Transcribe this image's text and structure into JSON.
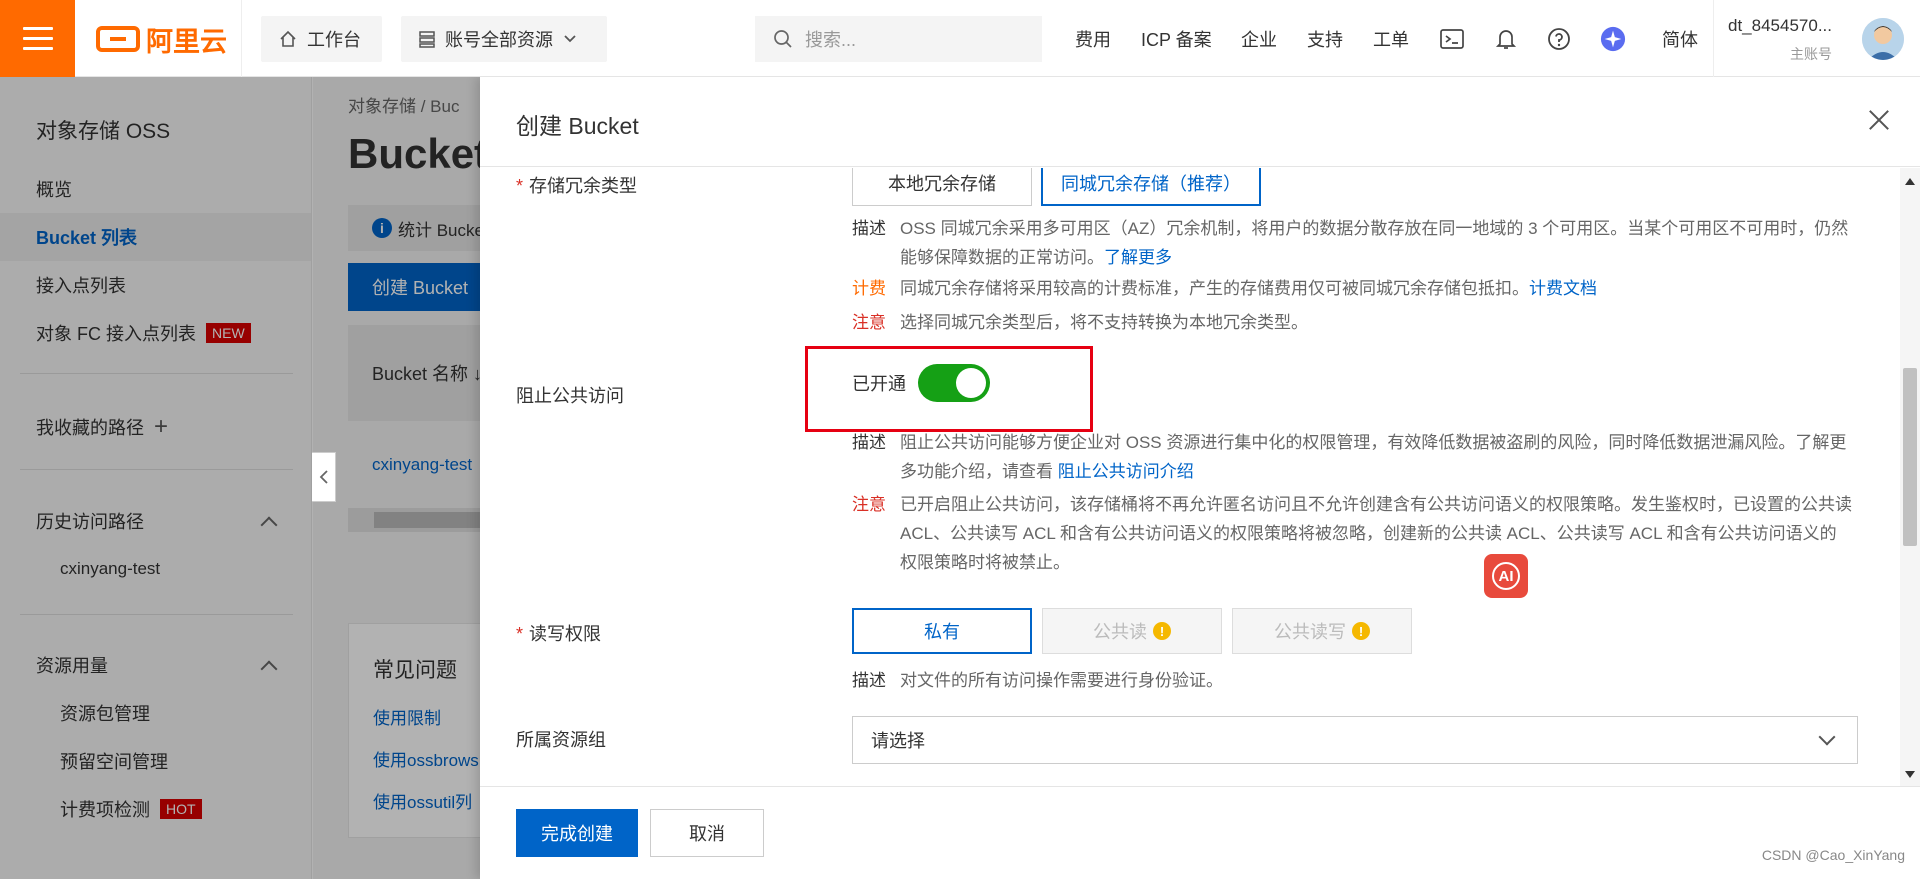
{
  "topbar": {
    "logo_text": "阿里云",
    "workbench": "工作台",
    "resources": "账号全部资源",
    "search_placeholder": "搜索...",
    "nav": [
      "费用",
      "ICP 备案",
      "企业",
      "支持",
      "工单"
    ],
    "lang": "简体",
    "username": "dt_8454570...",
    "account_type": "主账号",
    "brand_color": "#ff6a00"
  },
  "sidebar": {
    "title": "对象存储 OSS",
    "items": [
      "概览",
      "Bucket 列表",
      "接入点列表",
      "对象 FC 接入点列表"
    ],
    "new_badge": "NEW",
    "favorites": "我收藏的路径",
    "history_title": "历史访问路径",
    "history_items": [
      "cxinyang-test"
    ],
    "usage_title": "资源用量",
    "usage_items": [
      "资源包管理",
      "预留空间管理",
      "计费项检测"
    ],
    "hot_badge": "HOT"
  },
  "main": {
    "breadcrumb": "对象存储  /  Buc",
    "title": "Bucket",
    "info": "统计 Bucke",
    "create_button": "创建 Bucket",
    "table_header": "Bucket 名称 ↓",
    "row": "cxinyang-test",
    "faq_title": "常见问题",
    "faq_links": [
      "使用限制",
      "使用ossbrows",
      "使用ossutil列"
    ]
  },
  "drawer": {
    "title": "创建 Bucket",
    "redundancy": {
      "label": "存储冗余类型",
      "options": [
        "本地冗余存储",
        "同城冗余存储（推荐）"
      ],
      "desc_key": "描述",
      "desc": "OSS 同城冗余采用多可用区（AZ）冗余机制，将用户的数据分散存放在同一地域的 3 个可用区。当某个可用区不可用时，仍然能够保障数据的正常访问。",
      "desc_link": "了解更多",
      "fee_key": "计费",
      "fee": "同城冗余存储将采用较高的计费标准，产生的存储费用仅可被同城冗余存储包抵扣。",
      "fee_link": "计费文档",
      "note_key": "注意",
      "note": "选择同城冗余类型后，将不支持转换为本地冗余类型。"
    },
    "public_access": {
      "label": "阻止公共访问",
      "status": "已开通",
      "enabled": true,
      "desc_key": "描述",
      "desc": "阻止公共访问能够方便企业对 OSS 资源进行集中化的权限管理，有效降低数据被盗刷的风险，同时降低数据泄漏风险。了解更多功能介绍，请查看 ",
      "desc_link": "阻止公共访问介绍",
      "note_key": "注意",
      "note": "已开启阻止公共访问，该存储桶将不再允许匿名访问且不允许创建含有公共访问语义的权限策略。发生鉴权时，已设置的公共读 ACL、公共读写 ACL 和含有公共访问语义的权限策略将被忽略，创建新的公共读 ACL、公共读写 ACL 和含有公共访问语义的权限策略时将被禁止。",
      "toggle_color": "#15a015"
    },
    "acl": {
      "label": "读写权限",
      "options": [
        "私有",
        "公共读",
        "公共读写"
      ],
      "desc_key": "描述",
      "desc": "对文件的所有访问操作需要进行身份验证。"
    },
    "resource_group": {
      "label": "所属资源组",
      "placeholder": "请选择"
    },
    "ai_label": "AI",
    "submit": "完成创建",
    "cancel": "取消"
  },
  "watermark": "CSDN @Cao_XinYang"
}
